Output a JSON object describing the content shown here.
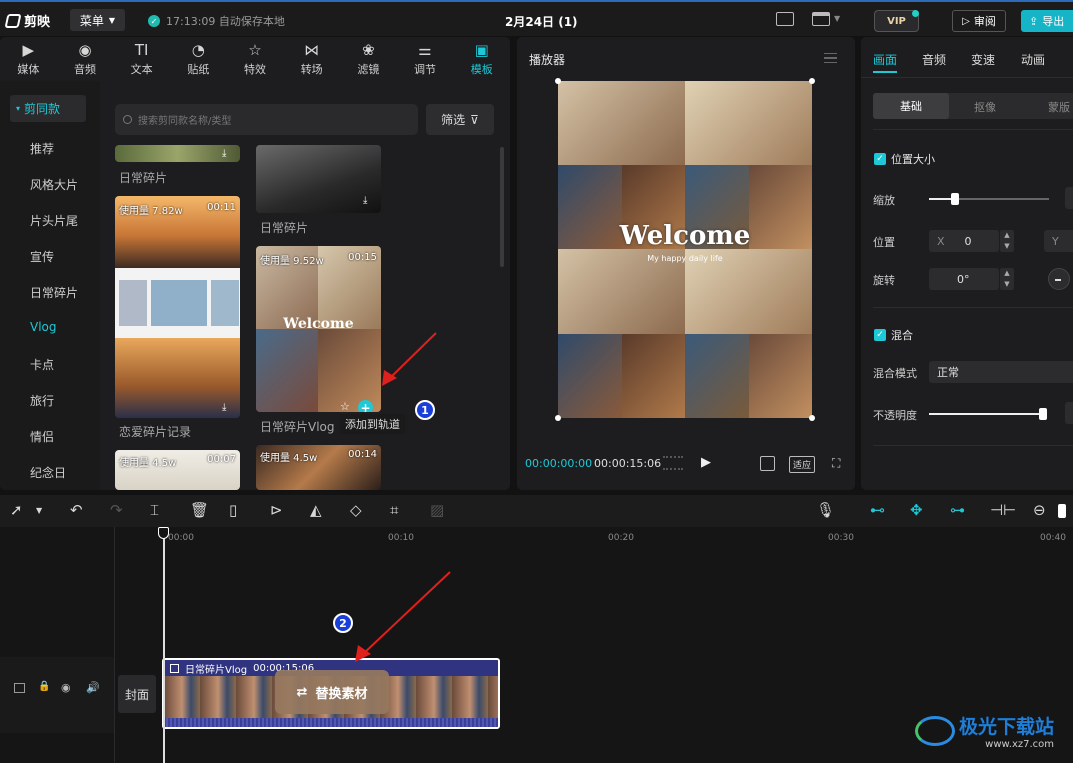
{
  "titlebar": {
    "app_name": "剪映",
    "menu_label": "菜单",
    "save_status": "17:13:09 自动保存本地",
    "project_title": "2月24日 (1)",
    "vip_label": "VIP",
    "review_label": "审阅",
    "export_label": "导出"
  },
  "tabs": [
    {
      "label": "媒体",
      "icon": "media-icon"
    },
    {
      "label": "音频",
      "icon": "audio-icon"
    },
    {
      "label": "文本",
      "icon": "text-icon"
    },
    {
      "label": "贴纸",
      "icon": "sticker-icon"
    },
    {
      "label": "特效",
      "icon": "effects-icon"
    },
    {
      "label": "转场",
      "icon": "transition-icon"
    },
    {
      "label": "滤镜",
      "icon": "filter-icon"
    },
    {
      "label": "调节",
      "icon": "adjust-icon"
    },
    {
      "label": "模板",
      "icon": "template-icon"
    }
  ],
  "sidebar": {
    "active": "剪同款",
    "items": [
      "推荐",
      "风格大片",
      "片头片尾",
      "宣传",
      "日常碎片",
      "Vlog",
      "卡点",
      "旅行",
      "情侣",
      "纪念日"
    ]
  },
  "search": {
    "placeholder": "搜索剪同款名称/类型",
    "filter_label": "筛选"
  },
  "templates": [
    {
      "label": "日常碎片"
    },
    {
      "label": "日常碎片"
    },
    {
      "usage": "使用量 7.82w",
      "duration": "00:11",
      "label": "恋爱碎片记录"
    },
    {
      "usage": "使用量 9.52w",
      "duration": "00:15",
      "label": "日常碎片Vlog",
      "tooltip": "添加到轨道"
    },
    {
      "usage": "使用量 4.5w",
      "duration": "00:07"
    },
    {
      "usage": "使用量 4.5w",
      "duration": "00:14"
    }
  ],
  "player": {
    "title": "播放器",
    "current_time": "00:00:00:00",
    "total_time": "00:00:15:06",
    "fit_label": "适应",
    "welcome_text": "Welcome",
    "sub_text": "My happy daily life"
  },
  "props": {
    "tabs": [
      "画面",
      "音频",
      "变速",
      "动画"
    ],
    "subtabs": [
      "基础",
      "抠像",
      "蒙版"
    ],
    "section_position": "位置大小",
    "scale_label": "缩放",
    "position_label": "位置",
    "pos_x_label": "X",
    "pos_x": "0",
    "pos_y_label": "Y",
    "rotate_label": "旋转",
    "rotate_value": "0°",
    "section_blend": "混合",
    "blend_mode_label": "混合模式",
    "blend_mode_value": "正常",
    "opacity_label": "不透明度"
  },
  "timeline": {
    "ticks": [
      "00:00",
      "00:10",
      "00:20",
      "00:30",
      "00:40"
    ],
    "cover_label": "封面",
    "clip_title": "日常碎片Vlog",
    "clip_duration": "00:00:15:06",
    "replace_label": "替换素材"
  },
  "annotations": {
    "badge1": "1",
    "badge2": "2"
  },
  "watermark": {
    "text": "极光下载站",
    "url": "www.xz7.com"
  },
  "colors": {
    "accent": "#1ec8d6",
    "badge": "#1a3fd8",
    "arrow": "#e0201c"
  }
}
